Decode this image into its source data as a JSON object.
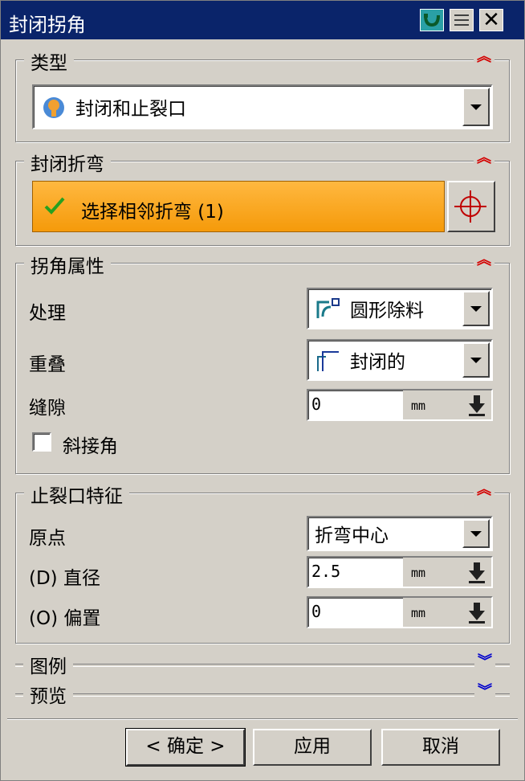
{
  "window": {
    "title": "封闭拐角"
  },
  "type_section": {
    "title": "类型",
    "selected": "封闭和止裂口"
  },
  "bend_section": {
    "title": "封闭折弯",
    "select_label": "选择相邻折弯 (1)"
  },
  "corner_section": {
    "title": "拐角属性",
    "treatment_label": "处理",
    "treatment_value": "圆形除料",
    "overlap_label": "重叠",
    "overlap_value": "封闭的",
    "gap_label": "缝隙",
    "gap_value": "0",
    "gap_unit": "mm",
    "miter_label": "斜接角"
  },
  "relief_section": {
    "title": "止裂口特征",
    "origin_label": "原点",
    "origin_value": "折弯中心",
    "diameter_label": "(D) 直径",
    "diameter_value": "2.5",
    "diameter_unit": "mm",
    "offset_label": "(O) 偏置",
    "offset_value": "0",
    "offset_unit": "mm"
  },
  "legend_section": {
    "title": "图例"
  },
  "preview_section": {
    "title": "预览"
  },
  "buttons": {
    "ok": "< 确定 >",
    "apply": "应用",
    "cancel": "取消"
  },
  "icons": {
    "collapse": "double-chevron-up-icon",
    "expand": "double-chevron-down-icon",
    "accent_collapse": "#d40000",
    "accent_expand": "#0000cc",
    "title_bar": "#0a246a",
    "select_button": "#f59a0a"
  }
}
